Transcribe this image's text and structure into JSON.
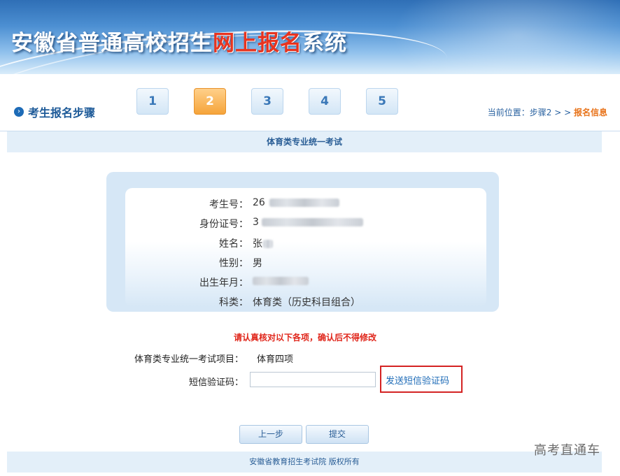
{
  "banner": {
    "title_prefix": "安徽省普通高校招生",
    "title_highlight": "网上报名",
    "title_suffix": "系统"
  },
  "steps": {
    "label": "考生报名步骤",
    "items": [
      "1",
      "2",
      "3",
      "4",
      "5"
    ],
    "active_index": 1
  },
  "breadcrumb": {
    "prefix": "当前位置：步骤2 > > ",
    "current": "报名信息"
  },
  "section": {
    "title": "体育类专业统一考试"
  },
  "info": {
    "rows": [
      {
        "label": "考生号：",
        "value": "26"
      },
      {
        "label": "身份证号：",
        "value": "3"
      },
      {
        "label": "姓名：",
        "value": "张"
      },
      {
        "label": "性别：",
        "value": "男"
      },
      {
        "label": "出生年月：",
        "value": ""
      },
      {
        "label": "科类：",
        "value": "体育类（历史科目组合）"
      }
    ]
  },
  "notice": "请认真核对以下各项，确认后不得修改",
  "form": {
    "project_label": "体育类专业统一考试项目：",
    "project_value": "体育四项",
    "sms_label": "短信验证码：",
    "sms_value": "",
    "sms_button": "发送短信验证码"
  },
  "buttons": {
    "prev": "上一步",
    "submit": "提交"
  },
  "footer": "安徽省教育招生考试院 版权所有",
  "watermark": "高考直通车",
  "colors": {
    "accent": "#1d6bb7",
    "active_step": "#f5a43a",
    "alert": "#e0261b",
    "highlight_box": "#d42323"
  }
}
